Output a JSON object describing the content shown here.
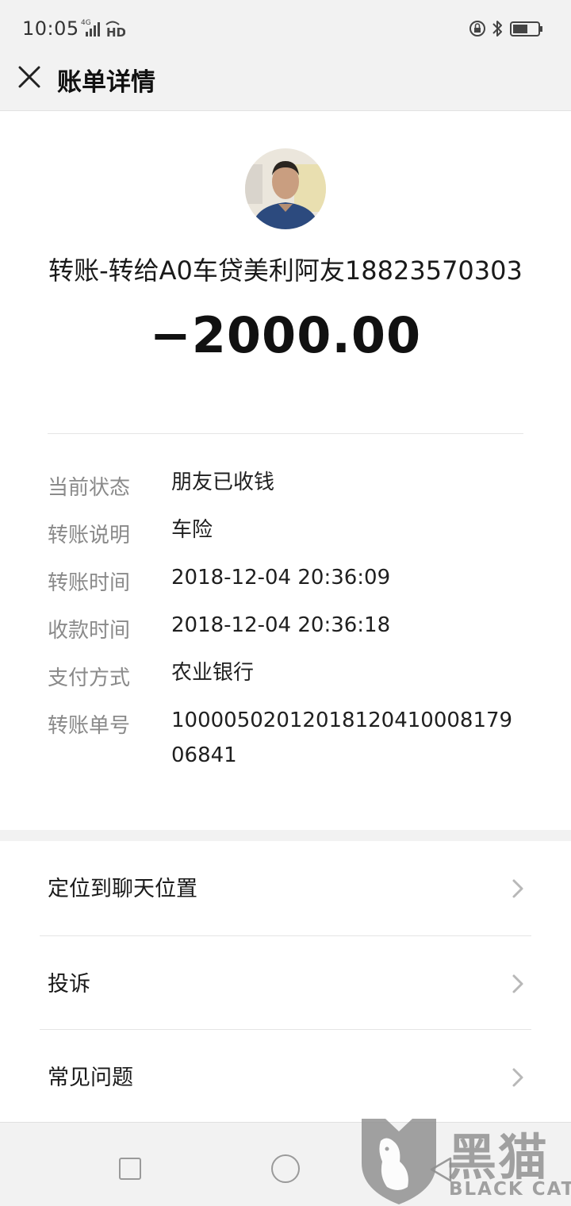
{
  "status_bar": {
    "time": "10:05",
    "network": "4G",
    "hd": "HD",
    "icons": [
      "rotation-lock-icon",
      "bluetooth-icon",
      "battery-icon"
    ]
  },
  "header": {
    "title": "账单详情",
    "close_icon": "close-icon"
  },
  "transaction": {
    "payee": "转账-转给A0车贷美利阿友18823570303",
    "amount": "−2000.00"
  },
  "details": [
    {
      "label": "当前状态",
      "value": "朋友已收钱"
    },
    {
      "label": "转账说明",
      "value": "车险"
    },
    {
      "label": "转账时间",
      "value": "2018-12-04 20:36:09"
    },
    {
      "label": "收款时间",
      "value": "2018-12-04 20:36:18"
    },
    {
      "label": "支付方式",
      "value": "农业银行"
    },
    {
      "label": "转账单号",
      "value": "1000050201201812041000817906841"
    }
  ],
  "menu": [
    {
      "label": "定位到聊天位置",
      "icon": "chevron-right-icon"
    },
    {
      "label": "投诉",
      "icon": "chevron-right-icon"
    },
    {
      "label": "常见问题",
      "icon": "chevron-right-icon"
    }
  ],
  "bottom_nav": {
    "icons": [
      "recents-square-icon",
      "home-circle-icon",
      "back-triangle-icon"
    ]
  },
  "watermark": {
    "text_cn": "黑猫",
    "text_en": "BLACK CAT"
  },
  "colors": {
    "bar_background": "#f2f2f2",
    "label_gray": "#8a8a8a",
    "divider": "#e5e5e5"
  }
}
